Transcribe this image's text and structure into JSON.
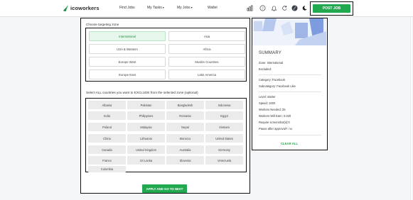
{
  "header": {
    "logo_text": "icoworkers",
    "nav": [
      {
        "label": "Find Jobs"
      },
      {
        "label": "My Tasks",
        "caret": "▾"
      },
      {
        "label": "My Jobs",
        "caret": "▾"
      },
      {
        "label": "Wallet"
      }
    ],
    "icons": [
      "pricing-icon",
      "help-icon",
      "notification-icon",
      "refresh-icon",
      "avatar",
      "dark-mode-icon"
    ],
    "post_job_label": "POST JOB"
  },
  "targeting": {
    "title": "Choose targeting zone",
    "zones": [
      {
        "label": "International",
        "selected": true
      },
      {
        "label": "Asia",
        "selected": false
      },
      {
        "label": "USA & Western",
        "selected": false
      },
      {
        "label": "Africa",
        "selected": false
      },
      {
        "label": "Europe West",
        "selected": false
      },
      {
        "label": "Muslim Countries",
        "selected": false
      },
      {
        "label": "Europe East",
        "selected": false
      },
      {
        "label": "Latin America",
        "selected": false
      }
    ]
  },
  "exclude": {
    "title": "Select ALL countries you want to EXCLUDE from the selected zone (optional)",
    "countries": [
      "Albania",
      "Pakistan",
      "Bangladesh",
      "Indonesia",
      "India",
      "Philippines",
      "Romania",
      "Egypt",
      "Poland",
      "Malaysia",
      "Nepal",
      "Vietnam",
      "China",
      "Lithuania",
      "Morocco",
      "United States",
      "Canada",
      "United Kingdom",
      "Australia",
      "Germany",
      "France",
      "Sri Lanka",
      "Slovenia",
      "Venezuela",
      "Colombia"
    ]
  },
  "apply_label": "APPLY AND GO TO NEXT",
  "summary": {
    "title": "SUMMARY",
    "zone": "Zone: International",
    "excluded": "Excluded:",
    "category": "Category: Facebook",
    "subcategory": "Subcategory: Facebook Like",
    "level": "Level: starter",
    "speed": "Speed: 1000",
    "workers_needed": "Workers Needed: 25",
    "workers_earn": "Workers Will Earn: 0.020",
    "screenshots": "Require screenshot(s):0",
    "pause": "Pause after approval?: no",
    "clear_all": "CLEAR ALL"
  },
  "colors": {
    "accent": "#22a94f",
    "selected_bg": "#e6f6ea",
    "chip_bg": "#ebebeb"
  }
}
